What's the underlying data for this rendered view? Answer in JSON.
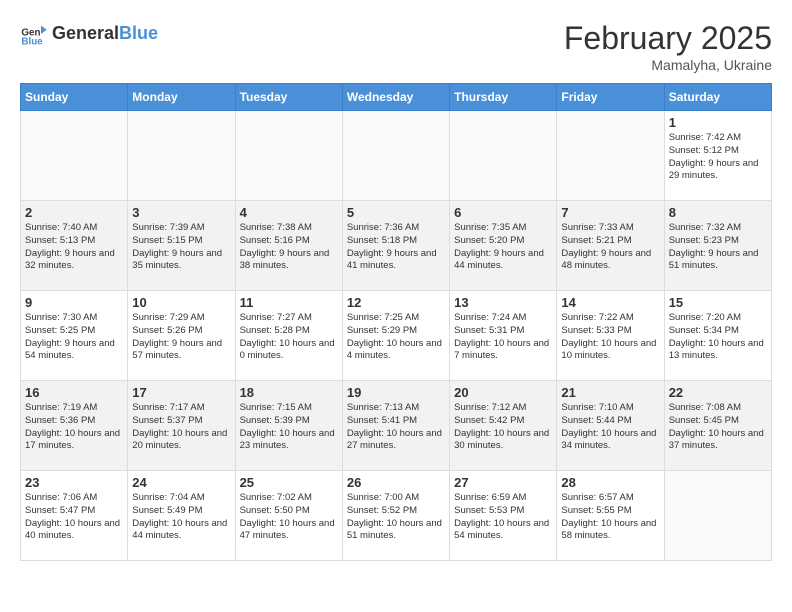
{
  "header": {
    "logo_text_general": "General",
    "logo_text_blue": "Blue",
    "month_year": "February 2025",
    "location": "Mamalyha, Ukraine"
  },
  "days_of_week": [
    "Sunday",
    "Monday",
    "Tuesday",
    "Wednesday",
    "Thursday",
    "Friday",
    "Saturday"
  ],
  "weeks": [
    {
      "alt": false,
      "days": [
        {
          "num": "",
          "info": ""
        },
        {
          "num": "",
          "info": ""
        },
        {
          "num": "",
          "info": ""
        },
        {
          "num": "",
          "info": ""
        },
        {
          "num": "",
          "info": ""
        },
        {
          "num": "",
          "info": ""
        },
        {
          "num": "1",
          "info": "Sunrise: 7:42 AM\nSunset: 5:12 PM\nDaylight: 9 hours and 29 minutes."
        }
      ]
    },
    {
      "alt": true,
      "days": [
        {
          "num": "2",
          "info": "Sunrise: 7:40 AM\nSunset: 5:13 PM\nDaylight: 9 hours and 32 minutes."
        },
        {
          "num": "3",
          "info": "Sunrise: 7:39 AM\nSunset: 5:15 PM\nDaylight: 9 hours and 35 minutes."
        },
        {
          "num": "4",
          "info": "Sunrise: 7:38 AM\nSunset: 5:16 PM\nDaylight: 9 hours and 38 minutes."
        },
        {
          "num": "5",
          "info": "Sunrise: 7:36 AM\nSunset: 5:18 PM\nDaylight: 9 hours and 41 minutes."
        },
        {
          "num": "6",
          "info": "Sunrise: 7:35 AM\nSunset: 5:20 PM\nDaylight: 9 hours and 44 minutes."
        },
        {
          "num": "7",
          "info": "Sunrise: 7:33 AM\nSunset: 5:21 PM\nDaylight: 9 hours and 48 minutes."
        },
        {
          "num": "8",
          "info": "Sunrise: 7:32 AM\nSunset: 5:23 PM\nDaylight: 9 hours and 51 minutes."
        }
      ]
    },
    {
      "alt": false,
      "days": [
        {
          "num": "9",
          "info": "Sunrise: 7:30 AM\nSunset: 5:25 PM\nDaylight: 9 hours and 54 minutes."
        },
        {
          "num": "10",
          "info": "Sunrise: 7:29 AM\nSunset: 5:26 PM\nDaylight: 9 hours and 57 minutes."
        },
        {
          "num": "11",
          "info": "Sunrise: 7:27 AM\nSunset: 5:28 PM\nDaylight: 10 hours and 0 minutes."
        },
        {
          "num": "12",
          "info": "Sunrise: 7:25 AM\nSunset: 5:29 PM\nDaylight: 10 hours and 4 minutes."
        },
        {
          "num": "13",
          "info": "Sunrise: 7:24 AM\nSunset: 5:31 PM\nDaylight: 10 hours and 7 minutes."
        },
        {
          "num": "14",
          "info": "Sunrise: 7:22 AM\nSunset: 5:33 PM\nDaylight: 10 hours and 10 minutes."
        },
        {
          "num": "15",
          "info": "Sunrise: 7:20 AM\nSunset: 5:34 PM\nDaylight: 10 hours and 13 minutes."
        }
      ]
    },
    {
      "alt": true,
      "days": [
        {
          "num": "16",
          "info": "Sunrise: 7:19 AM\nSunset: 5:36 PM\nDaylight: 10 hours and 17 minutes."
        },
        {
          "num": "17",
          "info": "Sunrise: 7:17 AM\nSunset: 5:37 PM\nDaylight: 10 hours and 20 minutes."
        },
        {
          "num": "18",
          "info": "Sunrise: 7:15 AM\nSunset: 5:39 PM\nDaylight: 10 hours and 23 minutes."
        },
        {
          "num": "19",
          "info": "Sunrise: 7:13 AM\nSunset: 5:41 PM\nDaylight: 10 hours and 27 minutes."
        },
        {
          "num": "20",
          "info": "Sunrise: 7:12 AM\nSunset: 5:42 PM\nDaylight: 10 hours and 30 minutes."
        },
        {
          "num": "21",
          "info": "Sunrise: 7:10 AM\nSunset: 5:44 PM\nDaylight: 10 hours and 34 minutes."
        },
        {
          "num": "22",
          "info": "Sunrise: 7:08 AM\nSunset: 5:45 PM\nDaylight: 10 hours and 37 minutes."
        }
      ]
    },
    {
      "alt": false,
      "days": [
        {
          "num": "23",
          "info": "Sunrise: 7:06 AM\nSunset: 5:47 PM\nDaylight: 10 hours and 40 minutes."
        },
        {
          "num": "24",
          "info": "Sunrise: 7:04 AM\nSunset: 5:49 PM\nDaylight: 10 hours and 44 minutes."
        },
        {
          "num": "25",
          "info": "Sunrise: 7:02 AM\nSunset: 5:50 PM\nDaylight: 10 hours and 47 minutes."
        },
        {
          "num": "26",
          "info": "Sunrise: 7:00 AM\nSunset: 5:52 PM\nDaylight: 10 hours and 51 minutes."
        },
        {
          "num": "27",
          "info": "Sunrise: 6:59 AM\nSunset: 5:53 PM\nDaylight: 10 hours and 54 minutes."
        },
        {
          "num": "28",
          "info": "Sunrise: 6:57 AM\nSunset: 5:55 PM\nDaylight: 10 hours and 58 minutes."
        },
        {
          "num": "",
          "info": ""
        }
      ]
    }
  ]
}
